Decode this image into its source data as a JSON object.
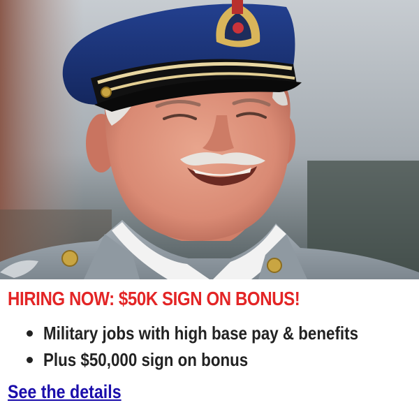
{
  "ad": {
    "headline": "HIRING NOW: $50K SIGN ON BONUS!",
    "bullets": [
      "Military jobs with high base pay & benefits",
      "Plus $50,000 sign on bonus"
    ],
    "cta_label": "See the details"
  },
  "colors": {
    "headline": "#e32526",
    "bullet_text": "#222222",
    "link": "#1a0dab"
  },
  "image": {
    "icon": "military-officer-photo"
  }
}
